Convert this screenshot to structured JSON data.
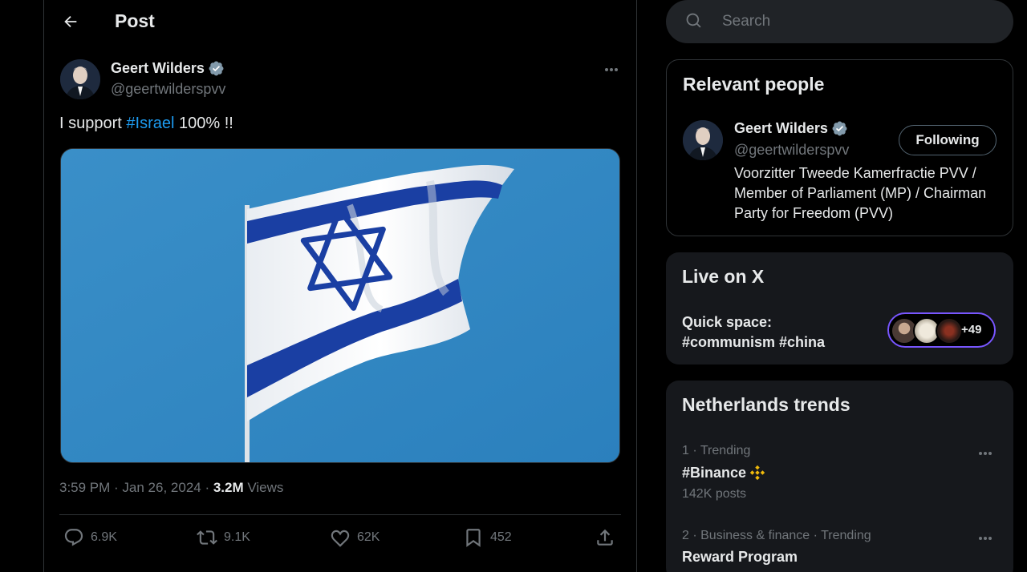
{
  "header": {
    "title": "Post",
    "back_icon": "arrow-left-icon"
  },
  "post": {
    "author_name": "Geert Wilders",
    "author_handle": "@geertwilderspvv",
    "text_prefix": "I support ",
    "hashtag": "#Israel",
    "text_suffix": " 100% !!",
    "timestamp": "3:59 PM · Jan 26, 2024 · ",
    "views_count": "3.2M",
    "views_label": " Views",
    "replies": "6.9K",
    "reposts": "9.1K",
    "likes": "62K",
    "bookmarks": "452"
  },
  "search": {
    "placeholder": "Search"
  },
  "relevant_people": {
    "title": "Relevant people",
    "name": "Geert Wilders",
    "handle": "@geertwilderspvv",
    "follow_label": "Following",
    "bio": "Voorzitter Tweede Kamerfractie PVV / Member of Parliament (MP) / Chairman Party for Freedom (PVV)"
  },
  "live": {
    "title": "Live on X",
    "space_line1": "Quick space:",
    "space_line2": "#communism #china",
    "listener_count": "+49"
  },
  "trends": {
    "title": "Netherlands trends",
    "items": [
      {
        "meta": "1 · Trending",
        "name": "#Binance",
        "count": "142K posts"
      },
      {
        "meta": "2 · Business & finance · Trending",
        "name": "Reward Program"
      }
    ]
  },
  "colors": {
    "accent": "#1d9bf0",
    "verified": "#829aab",
    "live_ring": "#7856ff",
    "background": "#000000"
  }
}
